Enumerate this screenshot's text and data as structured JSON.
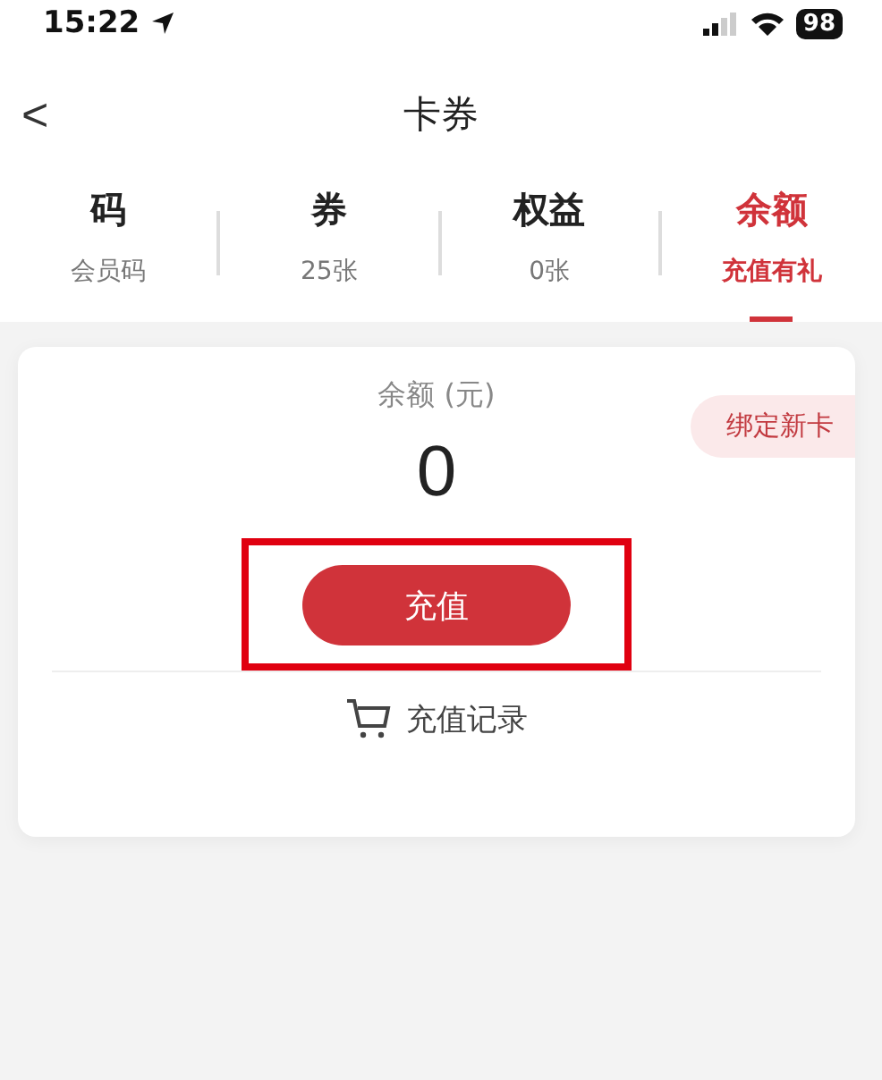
{
  "status_bar": {
    "time": "15:22",
    "battery": "98"
  },
  "header": {
    "back": "<",
    "title": "卡券"
  },
  "tabs": [
    {
      "label": "码",
      "sub": "会员码",
      "selected": false
    },
    {
      "label": "券",
      "sub": "25张",
      "selected": false
    },
    {
      "label": "权益",
      "sub": "0张",
      "selected": false
    },
    {
      "label": "余额",
      "sub": "充值有礼",
      "selected": true
    }
  ],
  "balance_card": {
    "caption": "余额 (元)",
    "amount": "0",
    "bind_button": "绑定新卡",
    "recharge_button": {
      "label": "充值",
      "highlighted": true
    },
    "history_link": "充值记录"
  }
}
